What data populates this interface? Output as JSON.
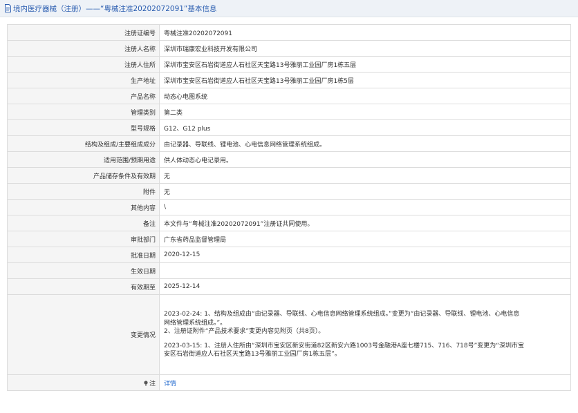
{
  "header": {
    "breadcrumb_label": "境内医疗器械（注册）",
    "separator": "——“粤械注准20202072091”基本信息"
  },
  "rows": [
    {
      "label": "注册证编号",
      "value": "粤械注准20202072091"
    },
    {
      "label": "注册人名称",
      "value": "深圳市瑞康宏业科技开发有限公司"
    },
    {
      "label": "注册人住所",
      "value": "深圳市宝安区石岩街道应人石社区天宝路13号雅丽工业园厂房1栋五层"
    },
    {
      "label": "生产地址",
      "value": "深圳市宝安区石岩街道应人石社区天宝路13号雅丽工业园厂房1栋5层"
    },
    {
      "label": "产品名称",
      "value": "动态心电图系统"
    },
    {
      "label": "管理类别",
      "value": "第二类"
    },
    {
      "label": "型号规格",
      "value": "G12、G12 plus"
    },
    {
      "label": "结构及组成/主要组成成分",
      "value": "由记录器、导联线、锂电池、心电信息网络管理系统组成。"
    },
    {
      "label": "适用范围/预期用途",
      "value": "供人体动态心电记录用。"
    },
    {
      "label": "产品储存条件及有效期",
      "value": "无"
    },
    {
      "label": "附件",
      "value": "无"
    },
    {
      "label": "其他内容",
      "value": "\\"
    },
    {
      "label": "备注",
      "value": "本文件与“粤械注准20202072091”注册证共同使用。"
    },
    {
      "label": "审批部门",
      "value": "广东省药品监督管理局"
    },
    {
      "label": "批准日期",
      "value": "2020-12-15"
    },
    {
      "label": "生效日期",
      "value": ""
    },
    {
      "label": "有效期至",
      "value": "2025-12-14"
    }
  ],
  "change": {
    "label": "变更情况",
    "line1": "2023-02-24: 1、结构及组成由“由记录器、导联线、心电信息网络管理系统组成。”变更为“由记录器、导联线、锂电池、心电信息",
    "line2": "网络管理系统组成。”。",
    "line3": "2、注册证附件“产品技术要求”变更内容见附页（共8页）。",
    "line4": "2023-03-15: 1、注册人住所由“深圳市宝安区新安街道82区新安六路1003号金融港A座七楼715、716、718号”变更为“深圳市宝",
    "line5": "安区石岩街道应人石社区天宝路13号雅丽工业园厂房1栋五层”。"
  },
  "note": {
    "label": "注",
    "link": "详情",
    "icon": "pin-icon"
  },
  "colors": {
    "header_bg": "#eef2f7",
    "header_text": "#2a5db0",
    "label_bg": "#f5f5f5",
    "border": "#dcdcdc",
    "link": "#2a6fd0"
  }
}
